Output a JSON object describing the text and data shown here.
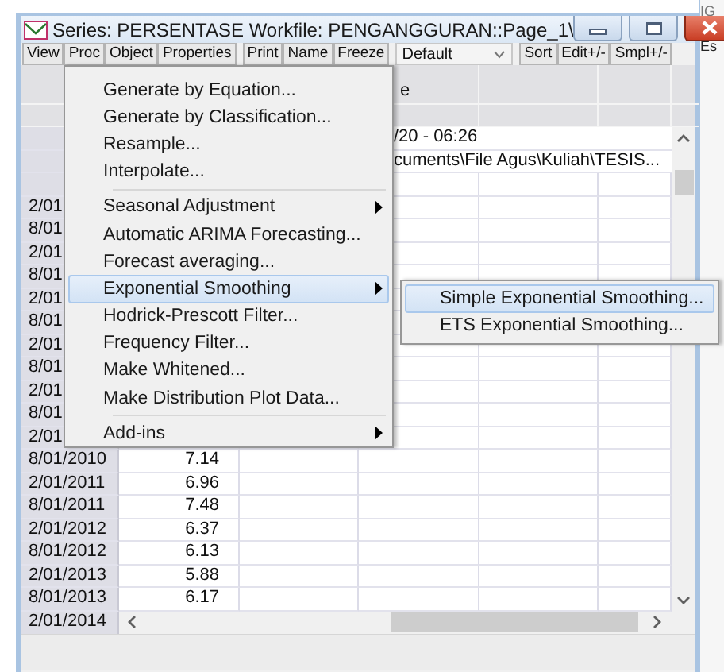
{
  "window": {
    "title": "Series: PERSENTASE   Workfile: PENGANGGURAN::Page_1\\"
  },
  "toolbar_groups": [
    [
      {
        "kind": "button",
        "label": "View"
      },
      {
        "kind": "button",
        "label": "Proc"
      },
      {
        "kind": "button",
        "label": "Object"
      },
      {
        "kind": "button",
        "label": "Properties"
      }
    ],
    [
      {
        "kind": "button",
        "label": "Print"
      },
      {
        "kind": "button",
        "label": "Name"
      },
      {
        "kind": "button",
        "label": "Freeze"
      }
    ],
    [
      {
        "kind": "dropdown",
        "label": "Default"
      }
    ],
    [
      {
        "kind": "button",
        "label": "Sort"
      },
      {
        "kind": "button",
        "label": "Edit+/-"
      },
      {
        "kind": "button",
        "label": "Smpl+/-"
      }
    ]
  ],
  "grid": {
    "header_text": "e",
    "info_lines": [
      "/20 - 06:26",
      "cuments\\File Agus\\Kuliah\\TESIS..."
    ],
    "rows": [
      {
        "label": "2/01"
      },
      {
        "label": "8/01"
      },
      {
        "label": "2/01"
      },
      {
        "label": "8/01"
      },
      {
        "label": "2/01"
      },
      {
        "label": "8/01"
      },
      {
        "label": "2/01"
      },
      {
        "label": "8/01"
      },
      {
        "label": "2/01"
      },
      {
        "label": "8/01"
      },
      {
        "label": "2/01"
      },
      {
        "label": "8/01/2010",
        "value": "7.14"
      },
      {
        "label": "2/01/2011",
        "value": "6.96"
      },
      {
        "label": "8/01/2011",
        "value": "7.48"
      },
      {
        "label": "2/01/2012",
        "value": "6.37"
      },
      {
        "label": "8/01/2012",
        "value": "6.13"
      },
      {
        "label": "2/01/2013",
        "value": "5.88"
      },
      {
        "label": "8/01/2013",
        "value": "6.17"
      }
    ],
    "last_row_label": "2/01/2014"
  },
  "menu": {
    "items": [
      {
        "kind": "item",
        "label": "Generate by Equation...",
        "has_submenu": false,
        "selected": false
      },
      {
        "kind": "item",
        "label": "Generate by Classification...",
        "has_submenu": false,
        "selected": false
      },
      {
        "kind": "item",
        "label": "Resample...",
        "has_submenu": false,
        "selected": false
      },
      {
        "kind": "item",
        "label": "Interpolate...",
        "has_submenu": false,
        "selected": false
      },
      {
        "kind": "separator"
      },
      {
        "kind": "item",
        "label": "Seasonal Adjustment",
        "has_submenu": true,
        "selected": false
      },
      {
        "kind": "item",
        "label": "Automatic ARIMA Forecasting...",
        "has_submenu": false,
        "selected": false
      },
      {
        "kind": "item",
        "label": "Forecast averaging...",
        "has_submenu": false,
        "selected": false
      },
      {
        "kind": "item",
        "label": "Exponential Smoothing",
        "has_submenu": true,
        "selected": true
      },
      {
        "kind": "item",
        "label": "Hodrick-Prescott Filter...",
        "has_submenu": false,
        "selected": false
      },
      {
        "kind": "item",
        "label": "Frequency Filter...",
        "has_submenu": false,
        "selected": false
      },
      {
        "kind": "item",
        "label": "Make Whitened...",
        "has_submenu": false,
        "selected": false
      },
      {
        "kind": "item",
        "label": "Make Distribution Plot Data...",
        "has_submenu": false,
        "selected": false
      },
      {
        "kind": "separator"
      },
      {
        "kind": "item",
        "label": "Add-ins",
        "has_submenu": true,
        "selected": false
      }
    ]
  },
  "submenu": {
    "items": [
      {
        "label": "Simple Exponential Smoothing...",
        "selected": true
      },
      {
        "label": "ETS Exponential Smoothing...",
        "selected": false
      }
    ]
  },
  "background_window": {
    "texts": [
      "IG",
      "Es"
    ]
  }
}
